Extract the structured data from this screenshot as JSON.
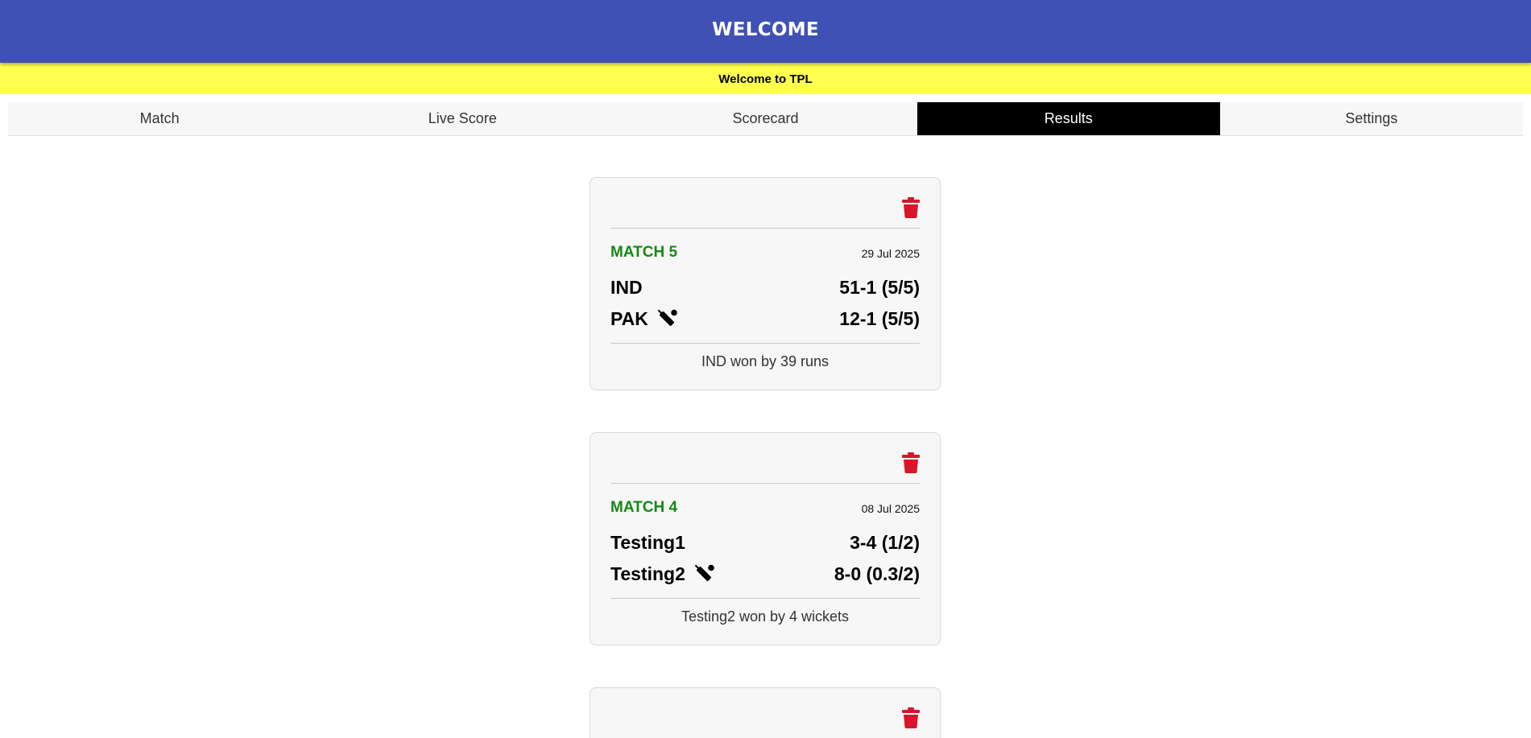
{
  "app_bar": {
    "title": "WELCOME"
  },
  "banner": {
    "text": "Welcome to TPL"
  },
  "tabs": [
    {
      "label": "Match",
      "active": false
    },
    {
      "label": "Live Score",
      "active": false
    },
    {
      "label": "Scorecard",
      "active": false
    },
    {
      "label": "Results",
      "active": true
    },
    {
      "label": "Settings",
      "active": false
    }
  ],
  "colors": {
    "app_bar": "#3f51b5",
    "banner": "#ffff4f",
    "active_tab": "#000000",
    "match_title": "#138a13",
    "delete_icon": "#d8152a"
  },
  "results": [
    {
      "match_label": "MATCH 5",
      "date": "29 Jul 2025",
      "team1": {
        "name": "IND",
        "score": "51-1 (5/5)",
        "batting_icon": false
      },
      "team2": {
        "name": "PAK",
        "score": "12-1 (5/5)",
        "batting_icon": true
      },
      "result": "IND won by 39 runs",
      "icons": {
        "delete": "trash-icon",
        "batting": "cricket-bat-icon"
      }
    },
    {
      "match_label": "MATCH 4",
      "date": "08 Jul 2025",
      "team1": {
        "name": "Testing1",
        "score": "3-4 (1/2)",
        "batting_icon": false
      },
      "team2": {
        "name": "Testing2",
        "score": "8-0 (0.3/2)",
        "batting_icon": true
      },
      "result": "Testing2 won by 4 wickets",
      "icons": {
        "delete": "trash-icon",
        "batting": "cricket-bat-icon"
      }
    },
    {
      "icons": {
        "delete": "trash-icon"
      }
    }
  ]
}
